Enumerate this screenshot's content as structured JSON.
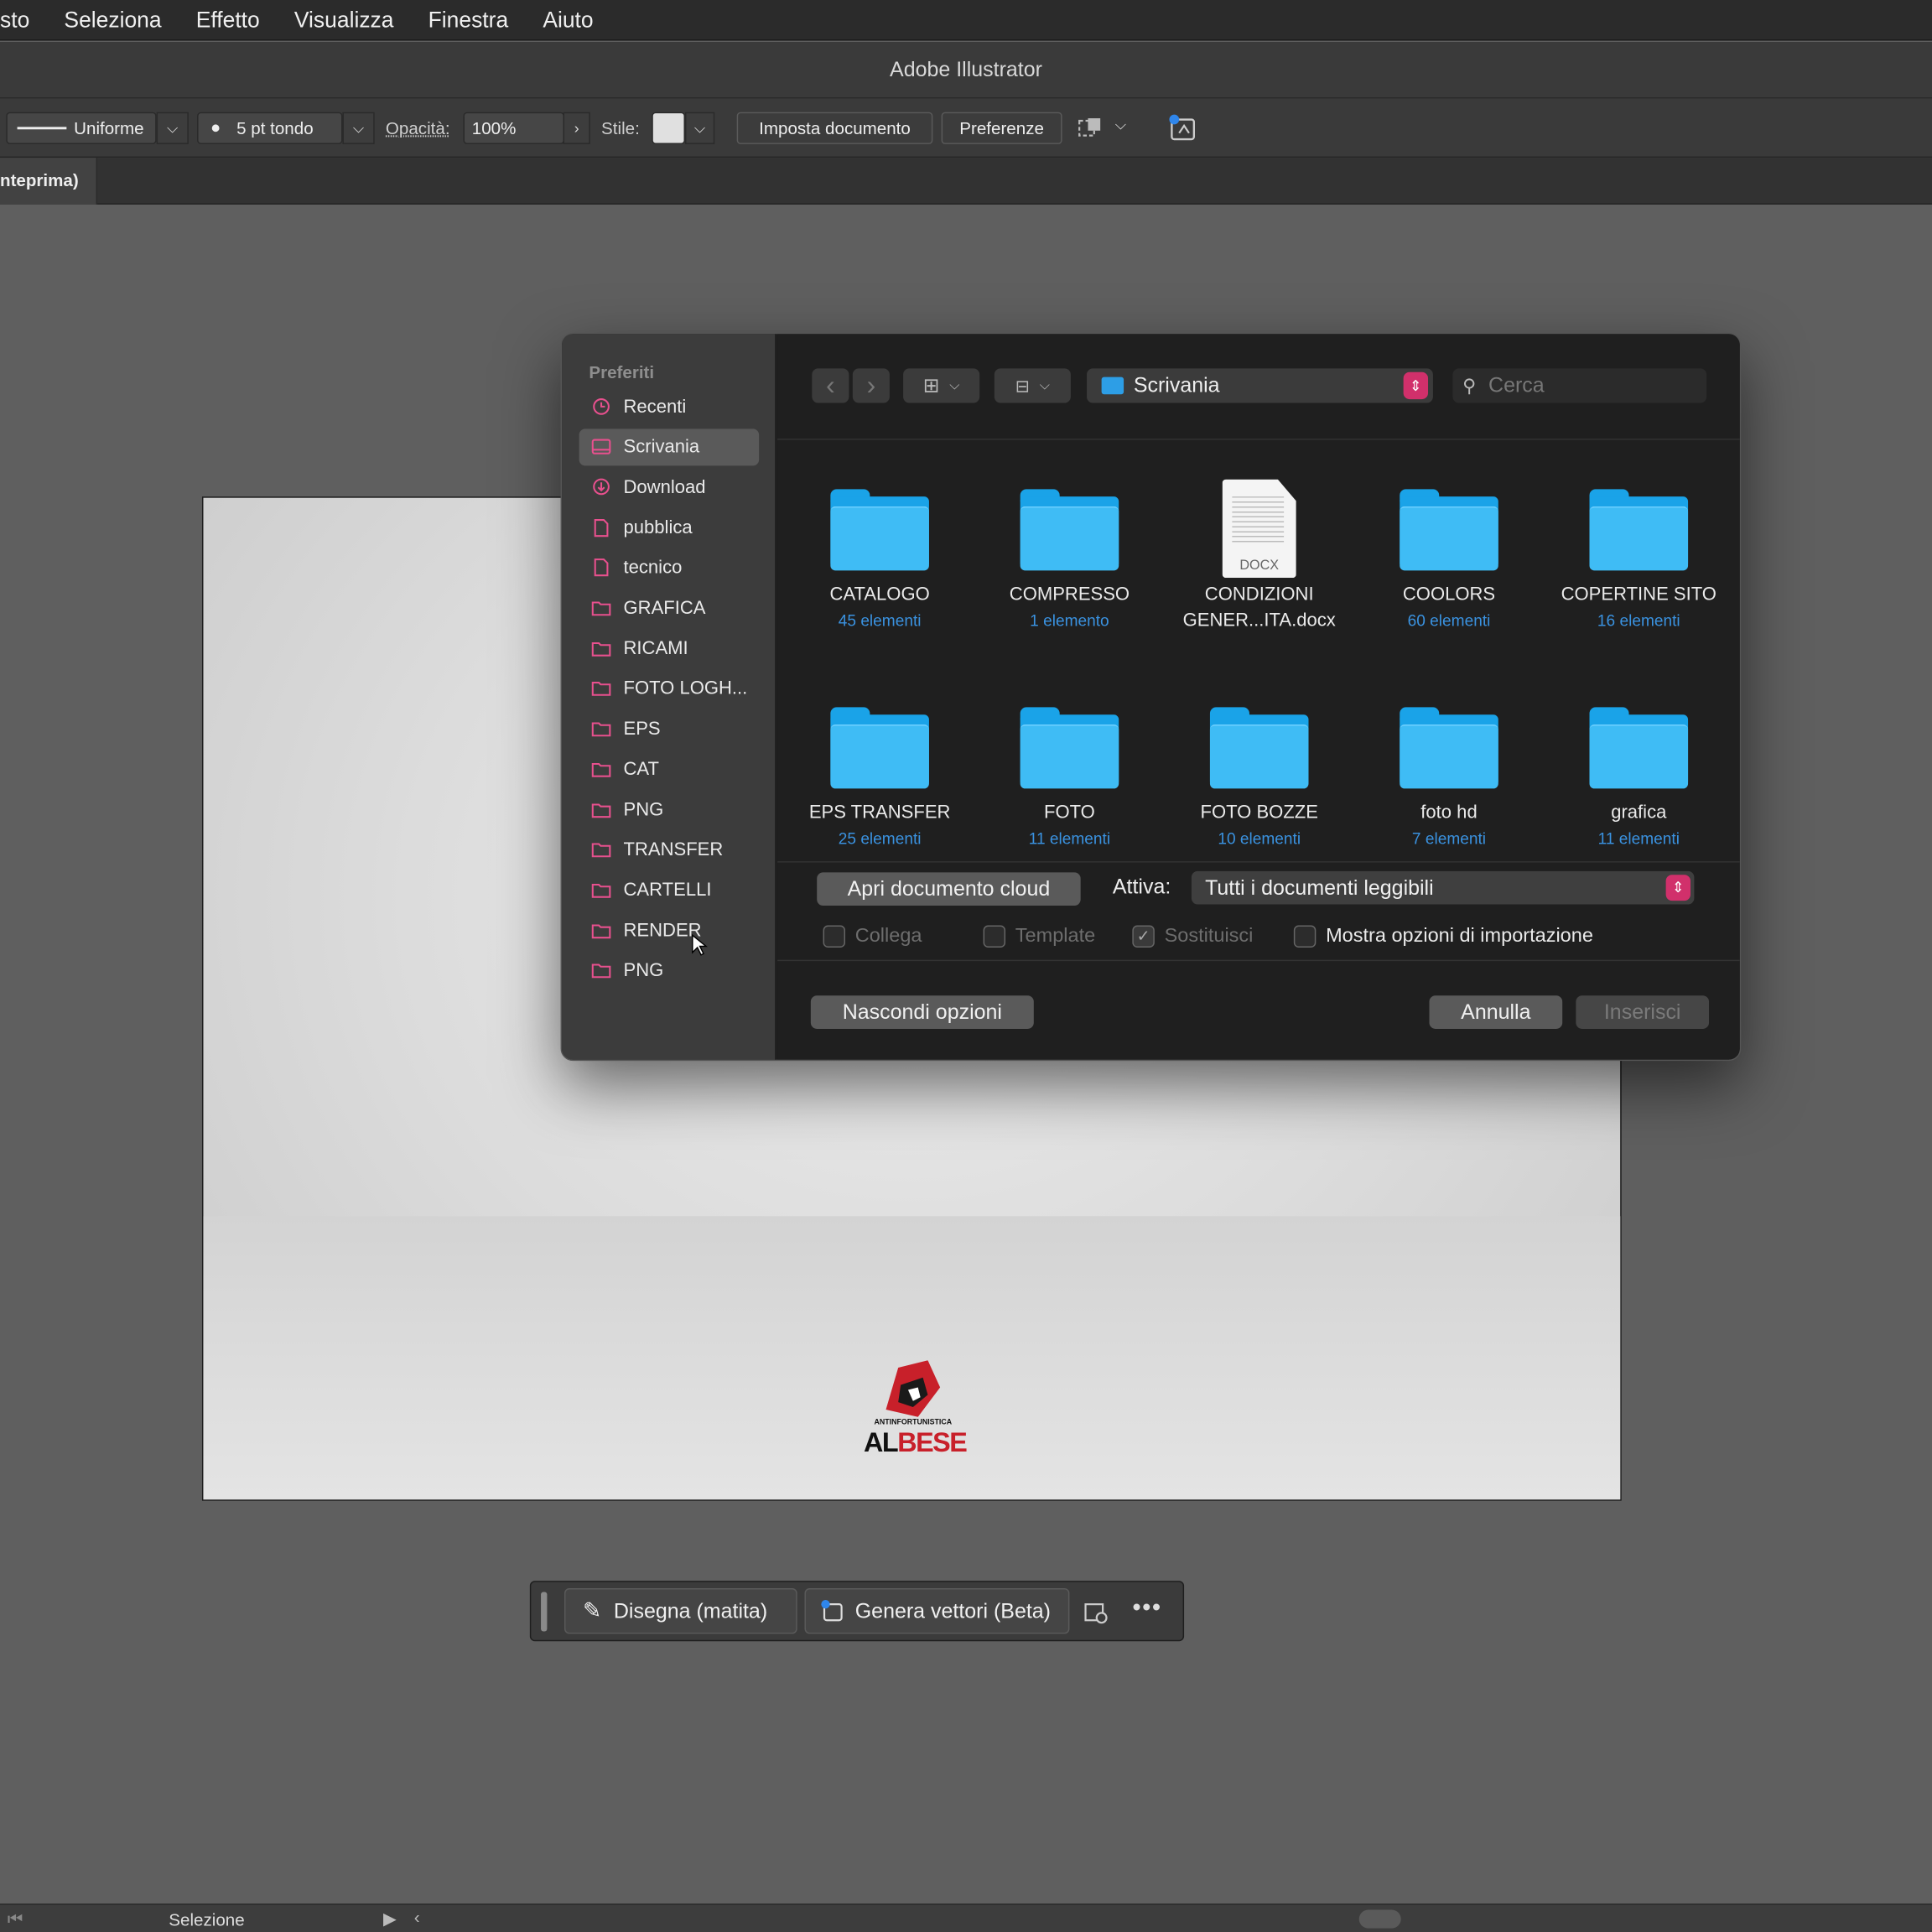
{
  "menubar": {
    "items": [
      "sto",
      "Seleziona",
      "Effetto",
      "Visualizza",
      "Finestra",
      "Aiuto"
    ]
  },
  "titlebar": {
    "title": "Adobe Illustrator"
  },
  "controlbar": {
    "stroke_style": "Uniforme",
    "brush": "5 pt tondo",
    "opacity_label": "Opacità:",
    "opacity_value": "100%",
    "style_label": "Stile:",
    "setup_document": "Imposta documento",
    "preferences": "Preferenze"
  },
  "tabs": [
    {
      "label": "nteprima)"
    }
  ],
  "artwork": {
    "logo_line1": "ANTINFORTUNISTICA",
    "logo_al": "AL",
    "logo_bese": "BESE"
  },
  "float_toolbar": {
    "draw": "Disegna (matita)",
    "generate": "Genera vettori (Beta)"
  },
  "statusbar": {
    "tool": "Selezione"
  },
  "dialog": {
    "sidebar": {
      "header": "Preferiti",
      "items": [
        {
          "label": "Recenti",
          "icon": "clock-icon"
        },
        {
          "label": "Scrivania",
          "icon": "desktop-icon",
          "selected": true
        },
        {
          "label": "Download",
          "icon": "download-icon"
        },
        {
          "label": "pubblica",
          "icon": "document-icon"
        },
        {
          "label": "tecnico",
          "icon": "document-icon"
        },
        {
          "label": "GRAFICA",
          "icon": "folder-icon"
        },
        {
          "label": "RICAMI",
          "icon": "folder-icon"
        },
        {
          "label": "FOTO LOGH...",
          "icon": "folder-icon"
        },
        {
          "label": "EPS",
          "icon": "folder-icon"
        },
        {
          "label": "CAT",
          "icon": "folder-icon"
        },
        {
          "label": "PNG",
          "icon": "folder-icon"
        },
        {
          "label": "TRANSFER",
          "icon": "folder-icon"
        },
        {
          "label": "CARTELLI",
          "icon": "folder-icon"
        },
        {
          "label": "RENDER",
          "icon": "folder-icon"
        },
        {
          "label": "PNG",
          "icon": "folder-icon"
        }
      ]
    },
    "toolbar": {
      "location": "Scrivania",
      "search_placeholder": "Cerca"
    },
    "files": [
      {
        "name": "CATALOGO",
        "count": "45 elementi",
        "type": "folder"
      },
      {
        "name": "COMPRESSO",
        "count": "1 elemento",
        "type": "folder"
      },
      {
        "name": "CONDIZIONI GENER...ITA.docx",
        "count": "",
        "type": "docx",
        "badge": "DOCX"
      },
      {
        "name": "COOLORS",
        "count": "60 elementi",
        "type": "folder"
      },
      {
        "name": "COPERTINE SITO",
        "count": "16 elementi",
        "type": "folder"
      },
      {
        "name": "EPS TRANSFER",
        "count": "25 elementi",
        "type": "folder"
      },
      {
        "name": "FOTO",
        "count": "11 elementi",
        "type": "folder"
      },
      {
        "name": "FOTO BOZZE",
        "count": "10 elementi",
        "type": "folder"
      },
      {
        "name": "foto hd",
        "count": "7 elementi",
        "type": "folder"
      },
      {
        "name": "grafica",
        "count": "11 elementi",
        "type": "folder"
      }
    ],
    "cloud_button": "Apri documento cloud",
    "enable_label": "Attiva:",
    "enable_value": "Tutti i documenti leggibili",
    "options": {
      "link": "Collega",
      "template": "Template",
      "replace": "Sostituisci",
      "show_import": "Mostra opzioni di importazione"
    },
    "hide_options": "Nascondi opzioni",
    "cancel": "Annulla",
    "insert": "Inserisci"
  }
}
